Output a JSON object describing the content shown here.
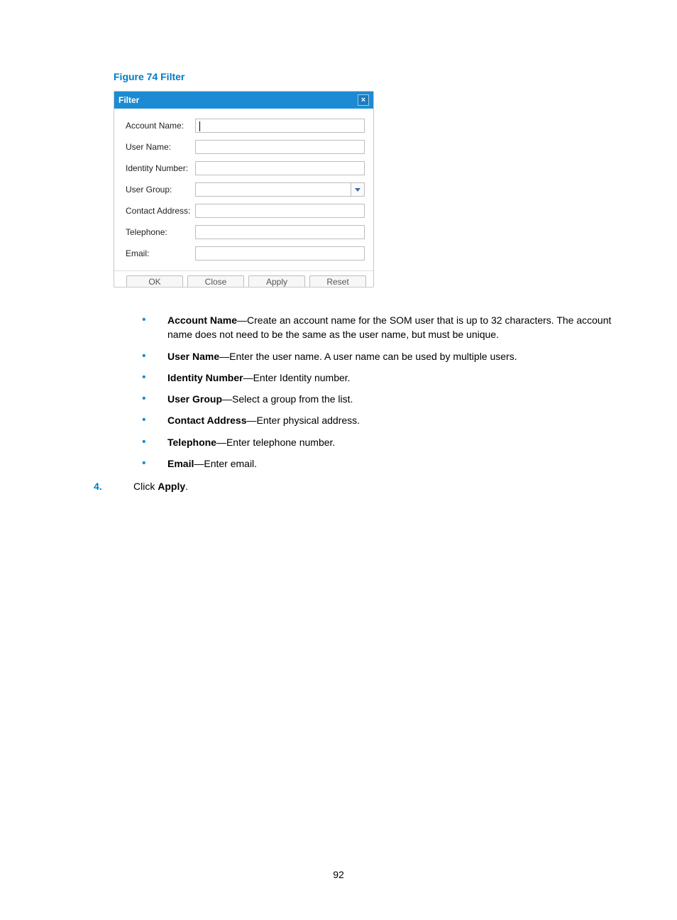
{
  "caption": "Figure 74 Filter",
  "dialog": {
    "title": "Filter",
    "fields": {
      "account_name": {
        "label": "Account Name:",
        "value": ""
      },
      "user_name": {
        "label": "User Name:",
        "value": ""
      },
      "identity": {
        "label": "Identity Number:",
        "value": ""
      },
      "user_group": {
        "label": "User Group:",
        "value": ""
      },
      "contact": {
        "label": "Contact Address:",
        "value": ""
      },
      "telephone": {
        "label": "Telephone:",
        "value": ""
      },
      "email": {
        "label": "Email:",
        "value": ""
      }
    },
    "buttons": {
      "ok": "OK",
      "close": "Close",
      "apply": "Apply",
      "reset": "Reset"
    }
  },
  "bullets": [
    {
      "term": "Account Name",
      "desc": "—Create an account name for the SOM user that is up to 32 characters.  The account name does not need to be the same as the user name, but must be unique."
    },
    {
      "term": "User Name",
      "desc": "—Enter the user name. A user name can be used by multiple users."
    },
    {
      "term": "Identity Number",
      "desc": "—Enter Identity number."
    },
    {
      "term": "User Group",
      "desc": "—Select a group from the list."
    },
    {
      "term": "Contact Address",
      "desc": "—Enter physical address."
    },
    {
      "term": "Telephone",
      "desc": "—Enter telephone number."
    },
    {
      "term": "Email",
      "desc": "—Enter email."
    }
  ],
  "step": {
    "num": "4.",
    "pre": "Click ",
    "bold": "Apply",
    "post": "."
  },
  "page_number": "92"
}
